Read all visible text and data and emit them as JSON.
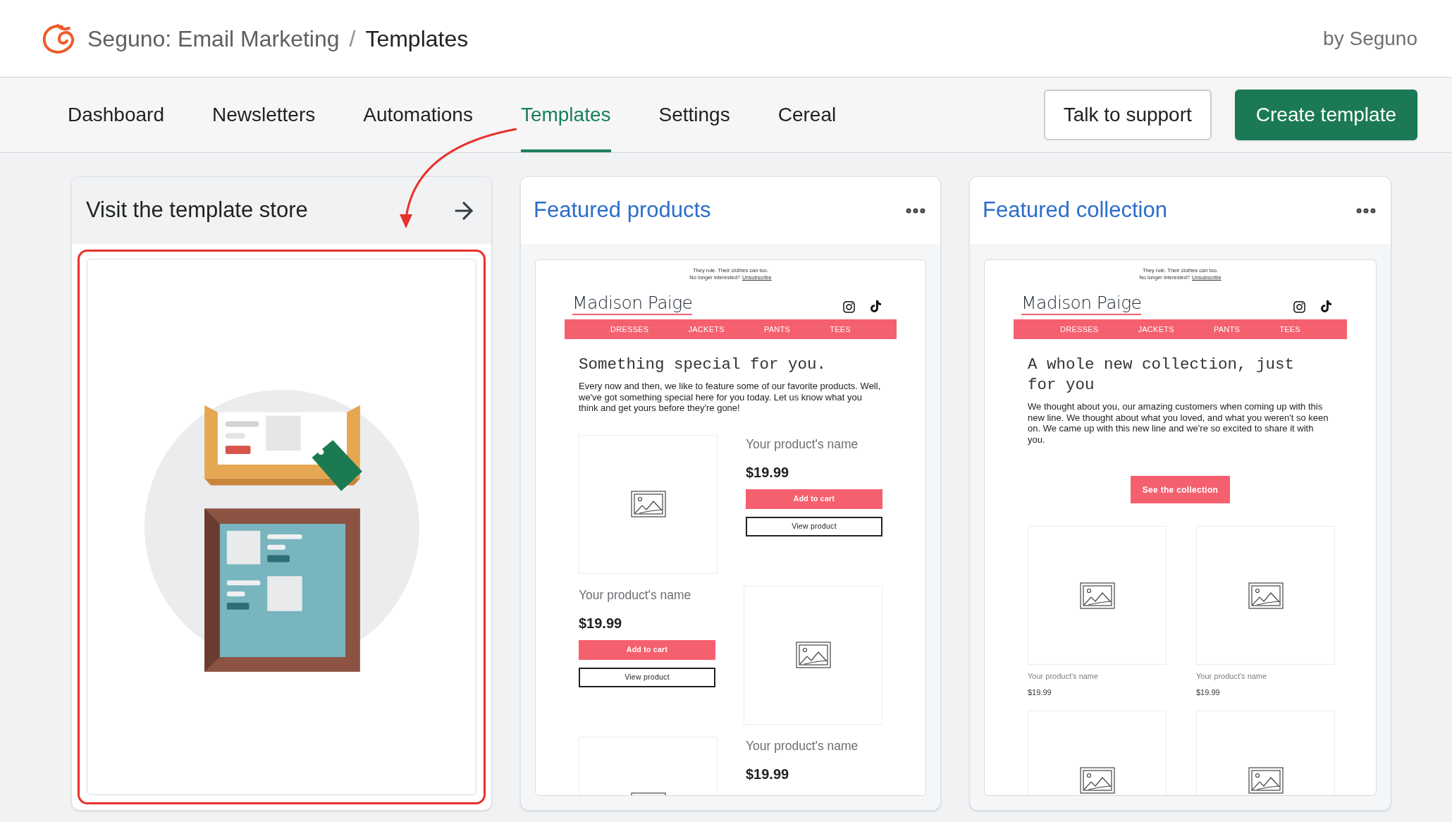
{
  "header": {
    "app": "Seguno: Email Marketing",
    "separator": "/",
    "page": "Templates",
    "by": "by Seguno"
  },
  "nav": {
    "tabs": [
      {
        "label": "Dashboard",
        "selected": false
      },
      {
        "label": "Newsletters",
        "selected": false
      },
      {
        "label": "Automations",
        "selected": false
      },
      {
        "label": "Templates",
        "selected": true
      },
      {
        "label": "Settings",
        "selected": false
      },
      {
        "label": "Cereal",
        "selected": false
      }
    ],
    "buttons": [
      {
        "label": "Talk to support",
        "kind": "secondary"
      },
      {
        "label": "Create template",
        "kind": "primary"
      }
    ]
  },
  "store_card": {
    "title": "Visit the template store",
    "highlighted": true,
    "arrow": true
  },
  "templates": [
    {
      "title": "Featured products",
      "kind": "products",
      "email": {
        "preheader": "They rule. Their clothes can too.",
        "unsubscribe_prompt": "No longer interested?",
        "unsubscribe_link": "Unsubscribe",
        "brand": "Madison Paige",
        "menu": [
          "DRESSES",
          "JACKETS",
          "PANTS",
          "TEES"
        ],
        "heading": "Something special for you.",
        "body": "Every now and then, we like to feature some of our favorite products. Well, we've got something special here for you today. Let us know what you think and get yours before they're gone!",
        "products": [
          {
            "image": true,
            "name": "Your product's name",
            "price": "$19.99",
            "add_button": "Add to cart",
            "view_button": "View product"
          },
          {
            "image": true,
            "name": "Your product's name",
            "price": "$19.99",
            "add_button": "Add to cart",
            "view_button": "View product"
          },
          {
            "image": true,
            "name": "Your product's name",
            "price": "$19.99"
          }
        ]
      }
    },
    {
      "title": "Featured collection",
      "kind": "collection",
      "email": {
        "preheader": "They rule. Their clothes can too.",
        "unsubscribe_prompt": "No longer interested?",
        "unsubscribe_link": "Unsubscribe",
        "brand": "Madison Paige",
        "menu": [
          "DRESSES",
          "JACKETS",
          "PANTS",
          "TEES"
        ],
        "heading": "A whole new collection, just for you",
        "body": "We thought about you, our amazing customers when coming up with this new line. We thought about what you loved, and what you weren't so keen on. We came up with this new line and we're so excited to share it with you.",
        "cta": "See the collection",
        "products": [
          {
            "image": true,
            "name": "Your product's name",
            "price": "$19.99"
          },
          {
            "image": true,
            "name": "Your product's name",
            "price": "$19.99"
          },
          {
            "image": true
          },
          {
            "image": true
          }
        ]
      }
    }
  ]
}
